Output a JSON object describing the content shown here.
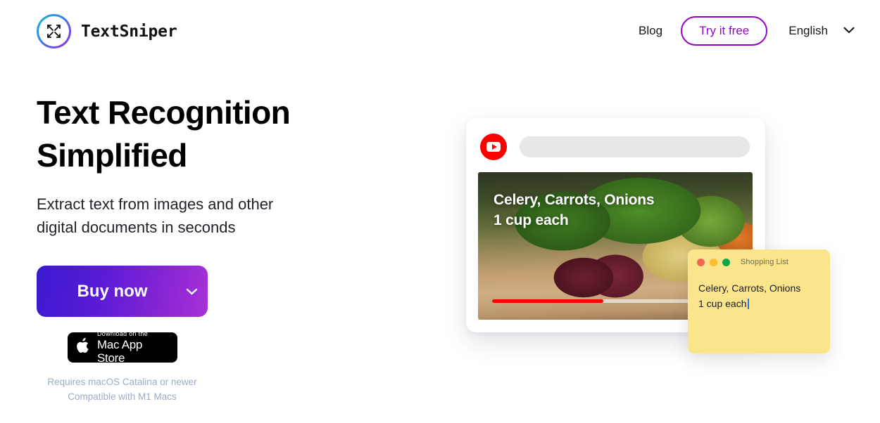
{
  "brand": {
    "name": "TextSniper",
    "logo_icon": "expand-arrows-icon"
  },
  "nav": {
    "blog_label": "Blog",
    "try_label": "Try it free",
    "language_label": "English",
    "language_chevron_icon": "chevron-down-icon"
  },
  "hero": {
    "headline_line1": "Text Recognition",
    "headline_line2": "Simplified",
    "subhead_line1": "Extract text from images and other",
    "subhead_line2": "digital documents in seconds",
    "buy_label": "Buy now",
    "buy_chevron_icon": "chevron-down-icon",
    "appstore": {
      "apple_icon": "apple-logo-icon",
      "small_text": "Download on the",
      "big_text": "Mac App Store"
    },
    "requirements_line1": "Requires macOS Catalina or newer",
    "requirements_line2": "Compatible with M1 Macs"
  },
  "illustration": {
    "browser": {
      "youtube_icon": "youtube-play-icon",
      "search_placeholder": "",
      "video": {
        "overlay_line1": "Celery, Carrots, Onions",
        "overlay_line2": "1 cup each",
        "progress_percent": 47
      }
    },
    "note": {
      "title": "Shopping List",
      "body_line1": "Celery, Carrots, Onions",
      "body_line2": "1 cup each",
      "traffic_lights": [
        "close-dot",
        "minimize-dot",
        "maximize-dot"
      ]
    }
  },
  "colors": {
    "brand_purple": "#9206C5",
    "gradient_start": "#3a1ad0",
    "gradient_end": "#a832d8",
    "youtube_red": "#FF0000",
    "note_yellow": "#FAE58C",
    "requirement_text": "#9aacc4"
  }
}
